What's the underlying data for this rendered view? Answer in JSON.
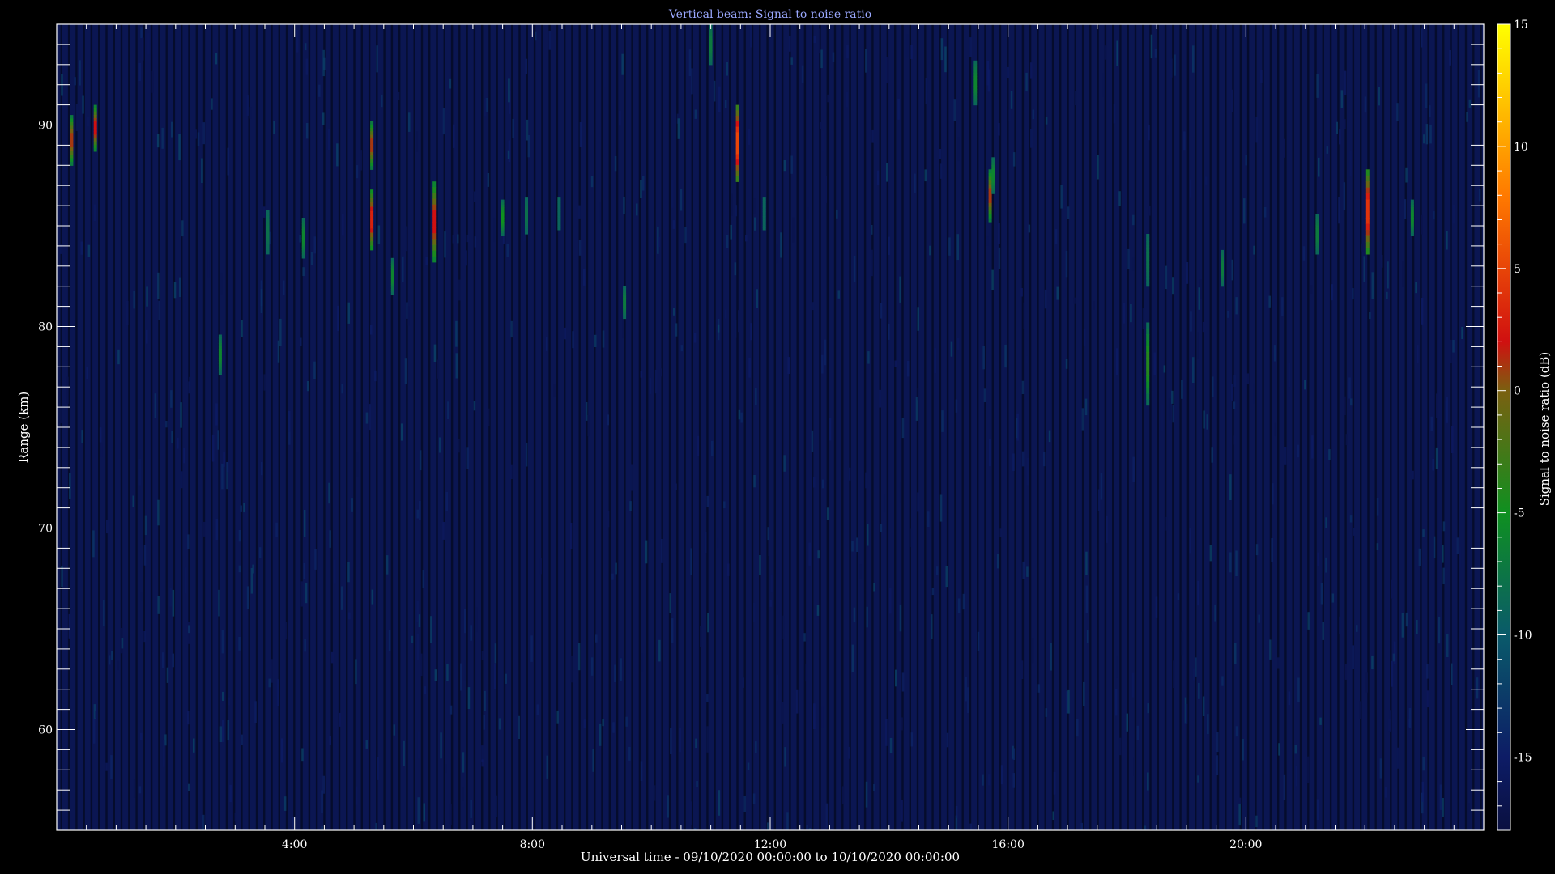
{
  "chart_data": {
    "type": "heatmap",
    "title": "Vertical beam: Signal to noise ratio",
    "xlabel": "Universal time - 09/10/2020 00:00:00 to 10/10/2020 00:00:00",
    "ylabel": "Range (km)",
    "colorbar_label": "Signal to noise ratio (dB)",
    "x_range_hours": [
      0,
      24
    ],
    "y_range_km": [
      55,
      95
    ],
    "colorbar_range_db": [
      -18,
      15
    ],
    "x_ticks": [
      {
        "value": 4,
        "label": "4:00"
      },
      {
        "value": 8,
        "label": "8:00"
      },
      {
        "value": 12,
        "label": "12:00"
      },
      {
        "value": 16,
        "label": "16:00"
      },
      {
        "value": 20,
        "label": "20:00"
      }
    ],
    "y_ticks": [
      {
        "value": 60,
        "label": "60"
      },
      {
        "value": 70,
        "label": "70"
      },
      {
        "value": 80,
        "label": "80"
      },
      {
        "value": 90,
        "label": "90"
      }
    ],
    "colorbar_ticks": [
      {
        "value": 15,
        "label": "15"
      },
      {
        "value": 10,
        "label": "10"
      },
      {
        "value": 5,
        "label": "5"
      },
      {
        "value": 0,
        "label": "0"
      },
      {
        "value": -5,
        "label": "-5"
      },
      {
        "value": -10,
        "label": "-10"
      },
      {
        "value": -15,
        "label": "-15"
      }
    ],
    "colormap_stops": [
      {
        "value": -18,
        "color": "#0a1040"
      },
      {
        "value": -15,
        "color": "#0d1c66"
      },
      {
        "value": -10,
        "color": "#0a5a6a"
      },
      {
        "value": -5,
        "color": "#0f9020"
      },
      {
        "value": 0,
        "color": "#7a6010"
      },
      {
        "value": 2,
        "color": "#d01010"
      },
      {
        "value": 8,
        "color": "#ff7a00"
      },
      {
        "value": 15,
        "color": "#ffff00"
      }
    ],
    "background_snr_db": -16,
    "echoes": [
      {
        "time_h": 0.25,
        "range_min_km": 88.0,
        "range_max_km": 90.5,
        "peak_db": 1
      },
      {
        "time_h": 0.65,
        "range_min_km": 88.7,
        "range_max_km": 91.0,
        "peak_db": 2
      },
      {
        "time_h": 2.75,
        "range_min_km": 77.6,
        "range_max_km": 79.6,
        "peak_db": -6
      },
      {
        "time_h": 3.55,
        "range_min_km": 83.6,
        "range_max_km": 85.8,
        "peak_db": -8
      },
      {
        "time_h": 4.15,
        "range_min_km": 83.4,
        "range_max_km": 85.4,
        "peak_db": -6
      },
      {
        "time_h": 5.3,
        "range_min_km": 87.8,
        "range_max_km": 90.2,
        "peak_db": 1
      },
      {
        "time_h": 5.3,
        "range_min_km": 83.8,
        "range_max_km": 86.8,
        "peak_db": 3
      },
      {
        "time_h": 5.65,
        "range_min_km": 81.6,
        "range_max_km": 83.4,
        "peak_db": -6
      },
      {
        "time_h": 6.35,
        "range_min_km": 83.2,
        "range_max_km": 87.2,
        "peak_db": 2
      },
      {
        "time_h": 7.5,
        "range_min_km": 84.5,
        "range_max_km": 86.3,
        "peak_db": -5
      },
      {
        "time_h": 7.9,
        "range_min_km": 84.6,
        "range_max_km": 86.4,
        "peak_db": -8
      },
      {
        "time_h": 8.45,
        "range_min_km": 84.8,
        "range_max_km": 86.4,
        "peak_db": -9
      },
      {
        "time_h": 9.55,
        "range_min_km": 80.4,
        "range_max_km": 82.0,
        "peak_db": -7
      },
      {
        "time_h": 11.0,
        "range_min_km": 93.0,
        "range_max_km": 95.0,
        "peak_db": -7
      },
      {
        "time_h": 11.45,
        "range_min_km": 87.2,
        "range_max_km": 91.0,
        "peak_db": 5
      },
      {
        "time_h": 11.9,
        "range_min_km": 84.8,
        "range_max_km": 86.4,
        "peak_db": -9
      },
      {
        "time_h": 15.45,
        "range_min_km": 91.0,
        "range_max_km": 93.2,
        "peak_db": -6
      },
      {
        "time_h": 15.7,
        "range_min_km": 85.2,
        "range_max_km": 87.8,
        "peak_db": 1
      },
      {
        "time_h": 15.75,
        "range_min_km": 86.6,
        "range_max_km": 88.4,
        "peak_db": -6
      },
      {
        "time_h": 18.35,
        "range_min_km": 76.1,
        "range_max_km": 80.2,
        "peak_db": -4
      },
      {
        "time_h": 18.35,
        "range_min_km": 82.0,
        "range_max_km": 84.6,
        "peak_db": -8
      },
      {
        "time_h": 19.6,
        "range_min_km": 82.0,
        "range_max_km": 83.8,
        "peak_db": -7
      },
      {
        "time_h": 21.2,
        "range_min_km": 83.6,
        "range_max_km": 85.6,
        "peak_db": -7
      },
      {
        "time_h": 22.05,
        "range_min_km": 83.6,
        "range_max_km": 87.8,
        "peak_db": 4
      },
      {
        "time_h": 22.8,
        "range_min_km": 84.5,
        "range_max_km": 86.3,
        "peak_db": -6
      }
    ]
  }
}
